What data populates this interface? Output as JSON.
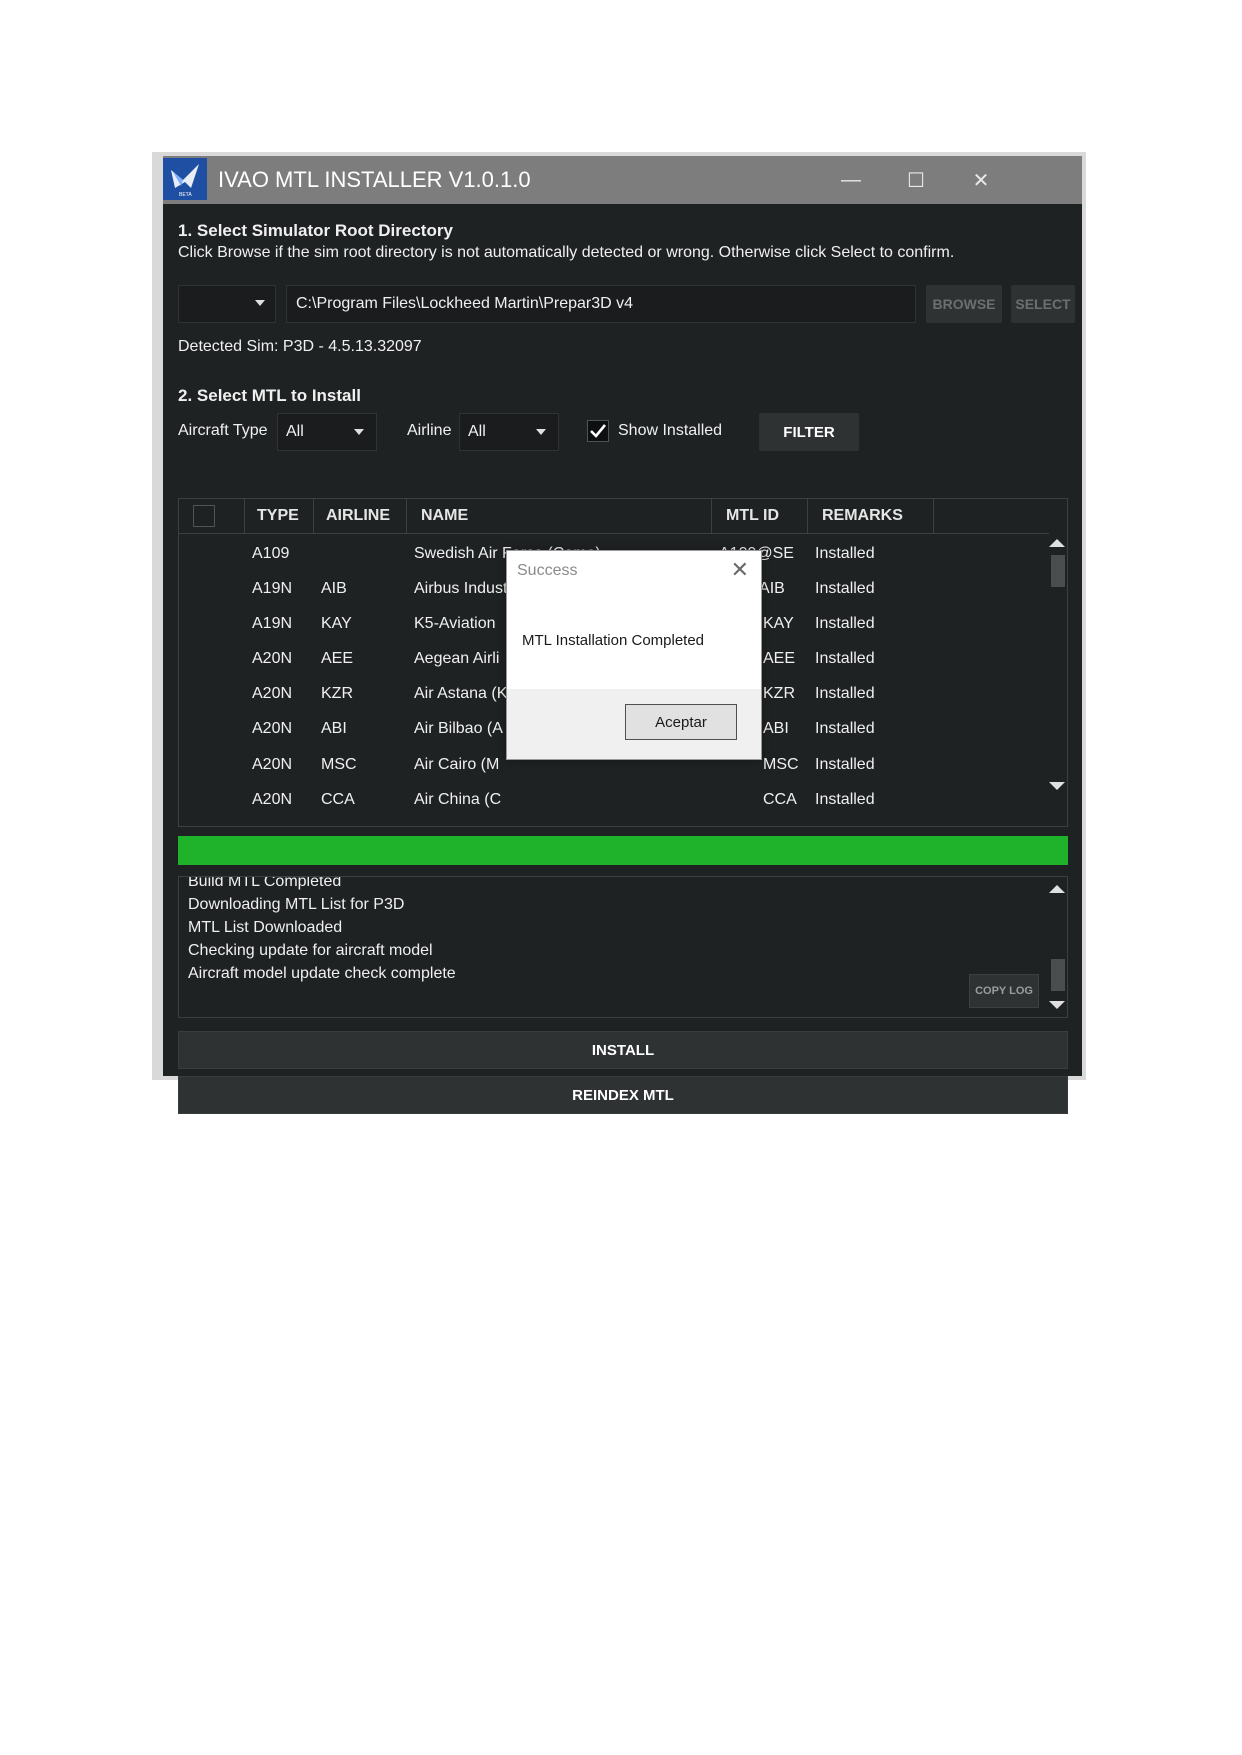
{
  "window": {
    "title": "IVAO MTL INSTALLER V1.0.1.0",
    "logo_text": "BETA",
    "controls": [
      "—",
      "☐",
      "✕"
    ]
  },
  "section1": {
    "heading": "1. Select Simulator Root Directory",
    "instructions": "Click Browse if the sim root directory is not automatically detected or wrong. Otherwise click Select to confirm.",
    "path_value": "C:\\Program Files\\Lockheed Martin\\Prepar3D v4",
    "browse_label": "BROWSE",
    "select_label": "SELECT",
    "detected": "Detected Sim: P3D - 4.5.13.32097"
  },
  "section2": {
    "heading": "2. Select MTL to Install",
    "aircraft_type_label": "Aircraft Type",
    "aircraft_type_value": "All",
    "airline_label": "Airline",
    "airline_value": "All",
    "show_installed_label": "Show Installed",
    "show_installed_checked": true,
    "filter_label": "FILTER"
  },
  "table": {
    "columns": [
      "TYPE",
      "AIRLINE",
      "NAME",
      "MTL ID",
      "REMARKS"
    ],
    "rows": [
      {
        "type": "A109",
        "airline": "",
        "name": "Swedish Air Force (Camo)",
        "mtl_id": "A109@SE",
        "remarks": "Installed"
      },
      {
        "type": "A19N",
        "airline": "AIB",
        "name": "Airbus Industries (AIB)",
        "mtl_id": "A19NAIB",
        "remarks": "Installed"
      },
      {
        "type": "A19N",
        "airline": "KAY",
        "name": "K5-Aviation",
        "mtl_id": "KAY",
        "remarks": "Installed"
      },
      {
        "type": "A20N",
        "airline": "AEE",
        "name": "Aegean Airli",
        "mtl_id": "AEE",
        "remarks": "Installed"
      },
      {
        "type": "A20N",
        "airline": "KZR",
        "name": "Air Astana (K",
        "mtl_id": "KZR",
        "remarks": "Installed"
      },
      {
        "type": "A20N",
        "airline": "ABI",
        "name": "Air Bilbao (A",
        "mtl_id": "ABI",
        "remarks": "Installed"
      },
      {
        "type": "A20N",
        "airline": "MSC",
        "name": "Air Cairo (M",
        "mtl_id": "MSC",
        "remarks": "Installed"
      },
      {
        "type": "A20N",
        "airline": "CCA",
        "name": "Air China (C",
        "mtl_id": "CCA",
        "remarks": "Installed"
      }
    ]
  },
  "progress": {
    "fraction": 1.0,
    "color": "#1eb32a"
  },
  "log": {
    "lines": [
      "Build MTL Completed",
      "Downloading MTL List for P3D",
      "MTL List Downloaded",
      "Checking update for aircraft model",
      "Aircraft model update check complete"
    ],
    "copy_label": "COPY LOG"
  },
  "actions": {
    "install_label": "INSTALL",
    "reindex_label": "REINDEX MTL"
  },
  "dialog": {
    "title": "Success",
    "message": "MTL Installation Completed",
    "ok_label": "Aceptar",
    "close_glyph": "✕"
  },
  "colors": {
    "titlebar": "#7d7d7d",
    "background": "#1f2223",
    "accent_green": "#1eb32a",
    "logo_blue": "#1f4fa3"
  }
}
